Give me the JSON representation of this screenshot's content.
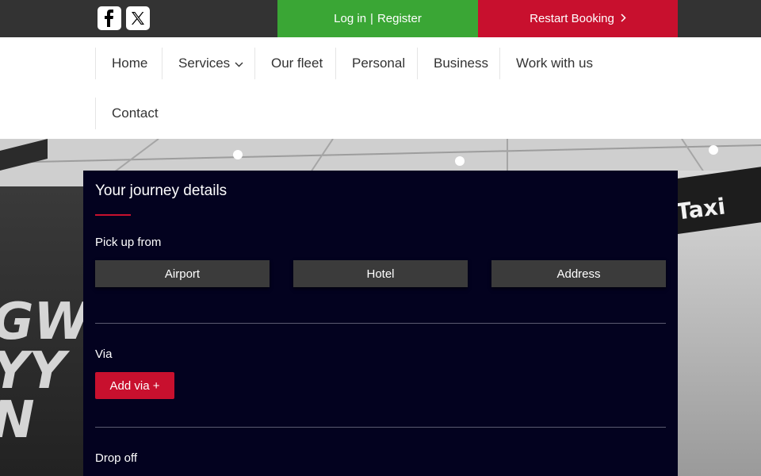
{
  "topbar": {
    "social": [
      {
        "name": "facebook-icon",
        "glyph": "f"
      },
      {
        "name": "x-icon",
        "glyph": "𝕏"
      }
    ],
    "login_label": "Log in",
    "separator": "|",
    "register_label": "Register",
    "restart_label": "Restart Booking",
    "colors": {
      "bar": "#333333",
      "login": "#3aa635",
      "restart": "#c8102e"
    }
  },
  "nav": {
    "items": [
      {
        "label": "Home"
      },
      {
        "label": "Services"
      },
      {
        "label": "Our fleet"
      },
      {
        "label": "Personal"
      },
      {
        "label": "Business"
      },
      {
        "label": "Work with us"
      },
      {
        "label": "Contact"
      }
    ]
  },
  "hero": {
    "sign_text": "Taxi",
    "graffiti_text": "GWI\nYY\nN"
  },
  "journey": {
    "title": "Your journey details",
    "pickup_label": "Pick up from",
    "pickup_options": [
      "Airport",
      "Hotel",
      "Address"
    ],
    "via_label": "Via",
    "add_via_label": "Add via +",
    "dropoff_label": "Drop off",
    "colors": {
      "panel": "#03021f",
      "accent": "#c8102e",
      "option": "#3b3b3b"
    }
  }
}
